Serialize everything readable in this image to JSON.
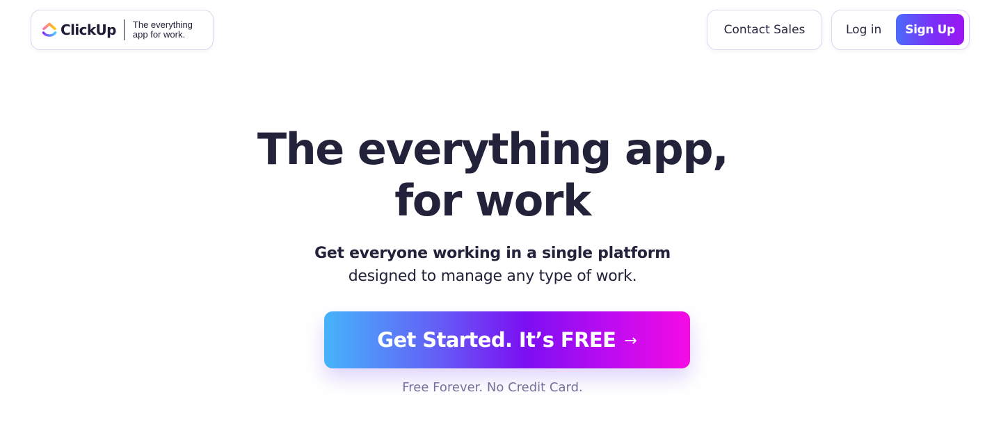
{
  "header": {
    "logo": {
      "wordmark": "ClickUp",
      "tagline": "The everything app for work.",
      "icon": "clickup-logo-icon",
      "colors": {
        "purple": "#7b68ee",
        "pink": "#fd71af",
        "orange": "#ffc800",
        "blue": "#49ccf9"
      }
    },
    "contact_sales_label": "Contact Sales",
    "login_label": "Log in",
    "signup_label": "Sign Up"
  },
  "hero": {
    "title_line1": "The everything app,",
    "title_line2": "for work",
    "subtitle_bold": "Get everyone working in a single platform",
    "subtitle_regular": "designed to manage any type of work.",
    "cta_label": "Get Started. It’s FREE",
    "cta_arrow": "→",
    "cta_note": "Free Forever. No Credit Card."
  },
  "colors": {
    "text": "#22223a",
    "muted": "#76709c",
    "border": "#d9d7f0",
    "cta_gradient": [
      "#45b4fb",
      "#7c0ff2",
      "#f40be4"
    ],
    "signup_gradient": [
      "#4b6bfa",
      "#9b16f2"
    ]
  }
}
